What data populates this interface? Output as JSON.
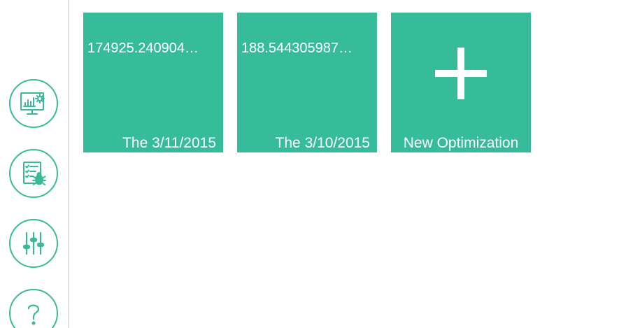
{
  "sidebar": {
    "items": [
      {
        "icon": "monitor-dashboard-icon"
      },
      {
        "icon": "checklist-bug-icon"
      },
      {
        "icon": "sliders-icon"
      },
      {
        "icon": "help-icon"
      }
    ]
  },
  "tiles": [
    {
      "value": "174925.240904…",
      "date": "The 3/11/2015"
    },
    {
      "value": "188.544305987…",
      "date": "The 3/10/2015"
    }
  ],
  "new_tile": {
    "label": "New Optimization",
    "icon": "plus-icon"
  },
  "colors": {
    "accent": "#36bc9b",
    "icon_stroke": "#39b999",
    "divider": "#e3e3e3",
    "text_on_accent": "#ffffff"
  }
}
